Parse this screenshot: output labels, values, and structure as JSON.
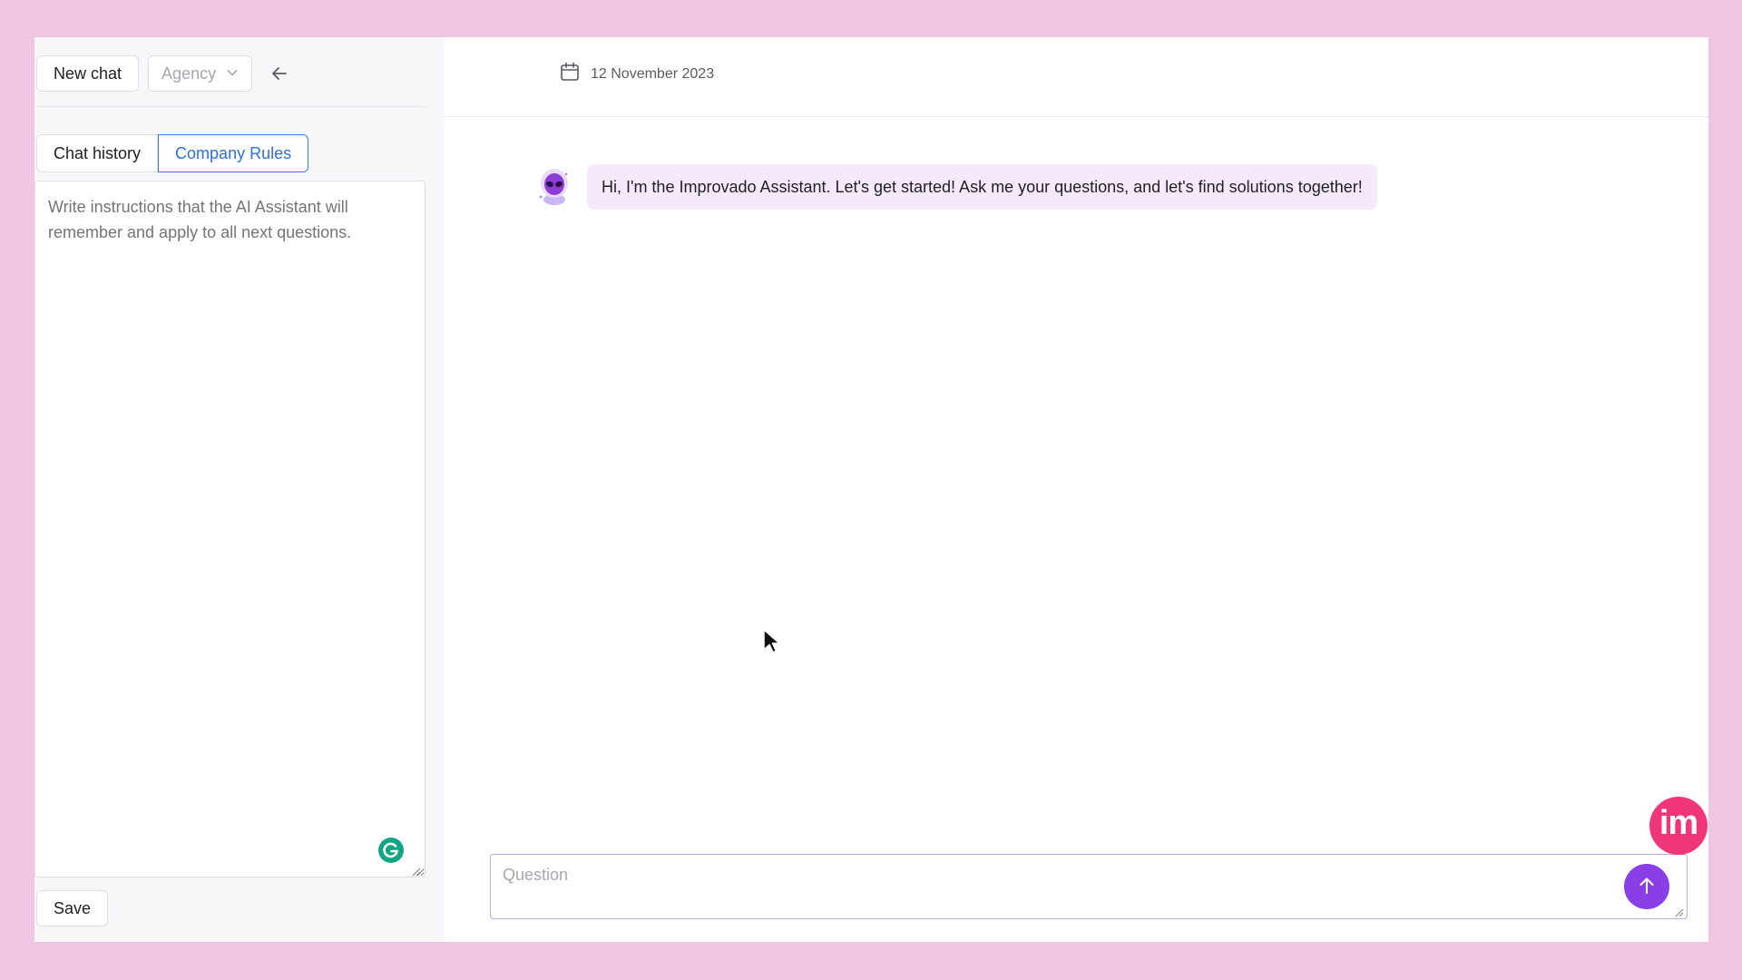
{
  "sidebar": {
    "new_chat_label": "New chat",
    "workspace_select": {
      "selected": "Agency"
    },
    "tabs": [
      {
        "label": "Chat history",
        "active": false
      },
      {
        "label": "Company Rules",
        "active": true
      }
    ],
    "rules_placeholder": "Write instructions that the AI Assistant will remember and apply to all next questions.",
    "save_label": "Save"
  },
  "header": {
    "date": "12 November 2023"
  },
  "chat": {
    "messages": [
      {
        "sender": "assistant",
        "text": "Hi, I'm the Improvado Assistant. Let's get started! Ask me your questions, and let's find solutions together!"
      }
    ]
  },
  "composer": {
    "placeholder": "Question"
  },
  "brand": {
    "badge_text": "im",
    "badge_color": "#f0357a",
    "accent_color": "#8a3ee6",
    "link_color": "#2f6fd6"
  },
  "icons": {
    "back": "arrow-left-icon",
    "calendar": "calendar-icon",
    "chevron": "chevron-down-icon",
    "send": "arrow-up-icon",
    "grammarly": "grammarly-icon",
    "avatar": "alien-avatar-icon"
  }
}
